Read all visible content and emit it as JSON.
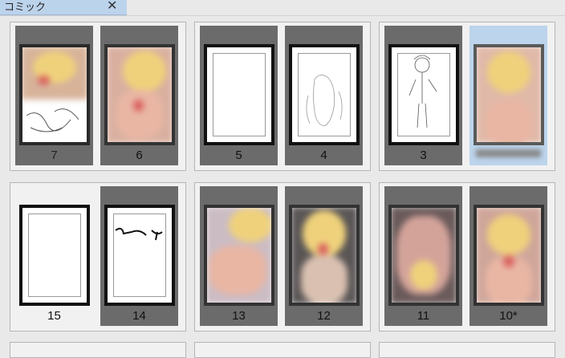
{
  "tab": {
    "label": "コミック",
    "close_glyph": "✕"
  },
  "spreads": [
    {
      "pages": [
        {
          "number": "7",
          "kind": "blurred-top"
        },
        {
          "number": "6",
          "kind": "blurred"
        }
      ]
    },
    {
      "pages": [
        {
          "number": "5",
          "kind": "blank"
        },
        {
          "number": "4",
          "kind": "sketch-figure"
        }
      ]
    },
    {
      "pages": [
        {
          "number": "3",
          "kind": "sketch-character"
        },
        {
          "number": "",
          "kind": "blurred"
        }
      ]
    },
    {
      "pages": [
        {
          "number": "15",
          "kind": "blank"
        },
        {
          "number": "14",
          "kind": "ink-strokes"
        }
      ]
    },
    {
      "pages": [
        {
          "number": "13",
          "kind": "blurred"
        },
        {
          "number": "12",
          "kind": "blurred"
        }
      ]
    },
    {
      "pages": [
        {
          "number": "11",
          "kind": "blurred"
        },
        {
          "number": "10*",
          "kind": "blurred"
        }
      ]
    }
  ],
  "colors": {
    "selected_page_bg": "#6b6b6b",
    "highlight_page_bg": "#bcd4ec",
    "tab_bg": "#bcd3ec"
  }
}
